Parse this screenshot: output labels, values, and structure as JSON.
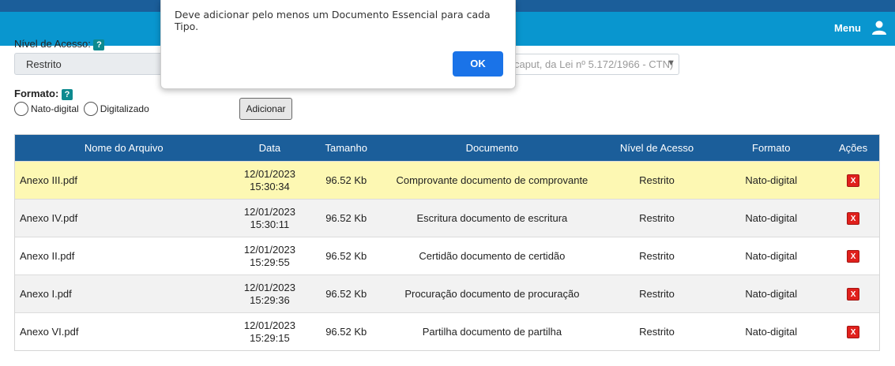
{
  "header": {
    "menu_label": "Menu",
    "user_icon": "user-icon"
  },
  "form": {
    "nivel_label": "Nível de Acesso:",
    "help_glyph": "?",
    "nivel_value": "Restrito",
    "hipotese_value": "caput, da Lei nº 5.172/1966 - CTN)",
    "formato_label": "Formato:",
    "radio_options": [
      "Nato-digital",
      "Digitalizado"
    ],
    "add_button": "Adicionar"
  },
  "table": {
    "columns": [
      "Nome do Arquivo",
      "Data",
      "Tamanho",
      "Documento",
      "Nível de Acesso",
      "Formato",
      "Ações"
    ],
    "rows": [
      {
        "name": "Anexo III.pdf",
        "date": "12/01/2023",
        "time": "15:30:34",
        "size": "96.52 Kb",
        "document": "Comprovante documento de comprovante",
        "nivel": "Restrito",
        "formato": "Nato-digital",
        "action": "X"
      },
      {
        "name": "Anexo IV.pdf",
        "date": "12/01/2023",
        "time": "15:30:11",
        "size": "96.52 Kb",
        "document": "Escritura documento de escritura",
        "nivel": "Restrito",
        "formato": "Nato-digital",
        "action": "X"
      },
      {
        "name": "Anexo II.pdf",
        "date": "12/01/2023",
        "time": "15:29:55",
        "size": "96.52 Kb",
        "document": "Certidão documento de certidão",
        "nivel": "Restrito",
        "formato": "Nato-digital",
        "action": "X"
      },
      {
        "name": "Anexo I.pdf",
        "date": "12/01/2023",
        "time": "15:29:36",
        "size": "96.52 Kb",
        "document": "Procuração documento de procuração",
        "nivel": "Restrito",
        "formato": "Nato-digital",
        "action": "X"
      },
      {
        "name": "Anexo VI.pdf",
        "date": "12/01/2023",
        "time": "15:29:15",
        "size": "96.52 Kb",
        "document": "Partilha documento de partilha",
        "nivel": "Restrito",
        "formato": "Nato-digital",
        "action": "X"
      }
    ]
  },
  "dialog": {
    "message": "Deve adicionar pelo menos um Documento Essencial para cada Tipo.",
    "ok_label": "OK"
  },
  "colors": {
    "header_dark": "#1b5e9a",
    "header_light": "#0996cf",
    "table_header": "#1b5e9a",
    "highlight_row": "#fdf8b3",
    "delete_button": "#e0201c",
    "ok_button": "#1a73e8"
  }
}
